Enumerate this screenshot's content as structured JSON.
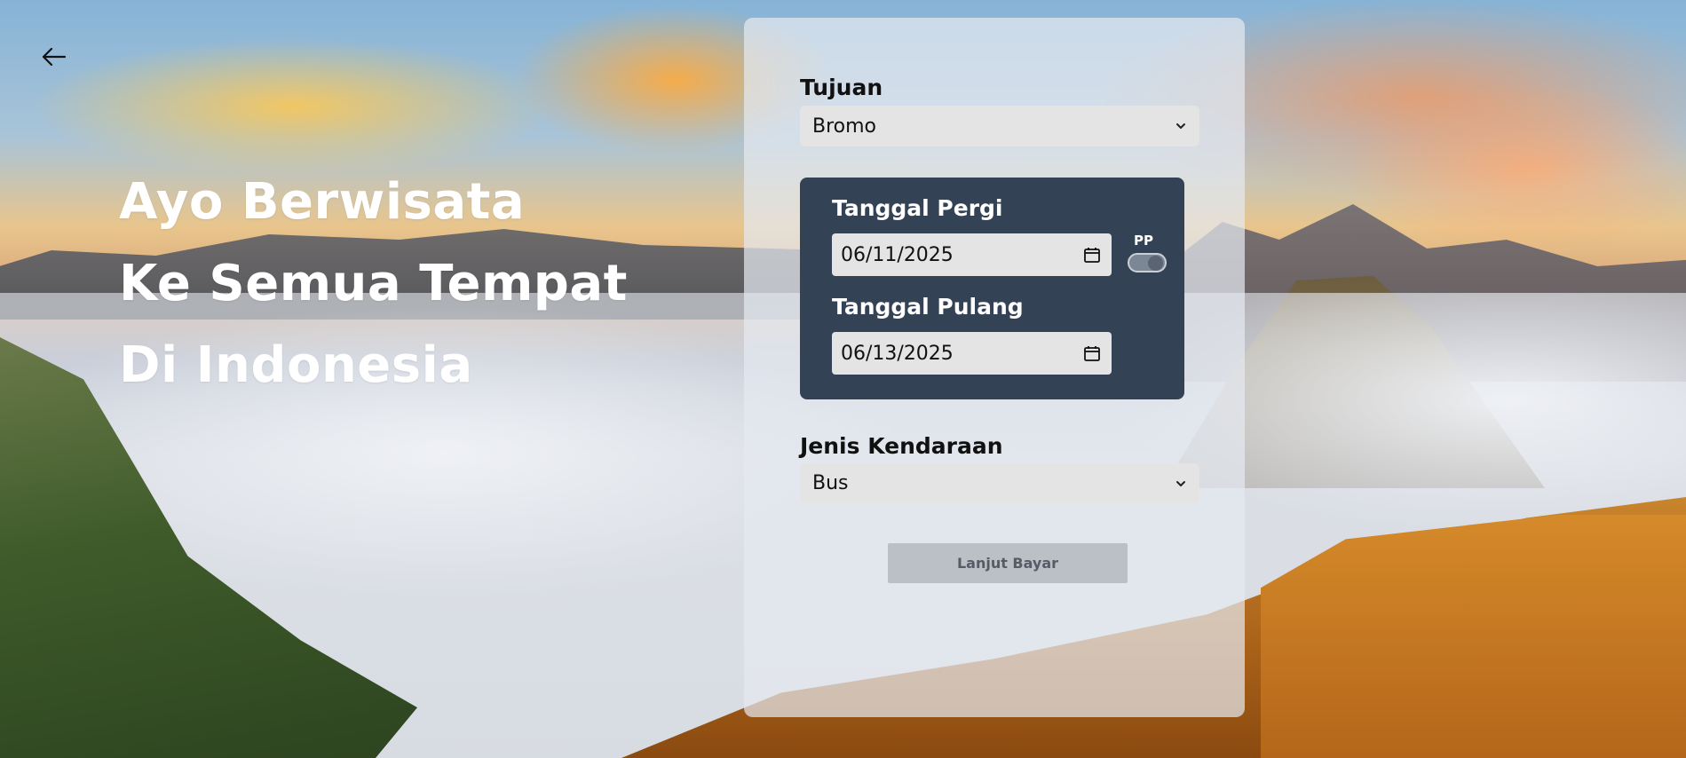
{
  "nav": {
    "back_icon": "arrow-left-icon"
  },
  "hero": {
    "line1": "Ayo Berwisata",
    "line2": "Ke Semua Tempat",
    "line3": "Di Indonesia"
  },
  "form": {
    "destination": {
      "label": "Tujuan",
      "value": "Bromo"
    },
    "departure": {
      "label": "Tanggal Pergi",
      "value": "06/11/2025"
    },
    "return": {
      "label": "Tanggal Pulang",
      "value": "06/13/2025"
    },
    "round_trip": {
      "label": "PP",
      "on": true
    },
    "vehicle": {
      "label": "Jenis Kendaraan",
      "value": "Bus"
    },
    "submit_label": "Lanjut Bayar"
  },
  "colors": {
    "panel": "#e5e9f0",
    "date_box": "#344256",
    "input_bg": "#e4e4e4",
    "hero_text": "#ffffff"
  }
}
